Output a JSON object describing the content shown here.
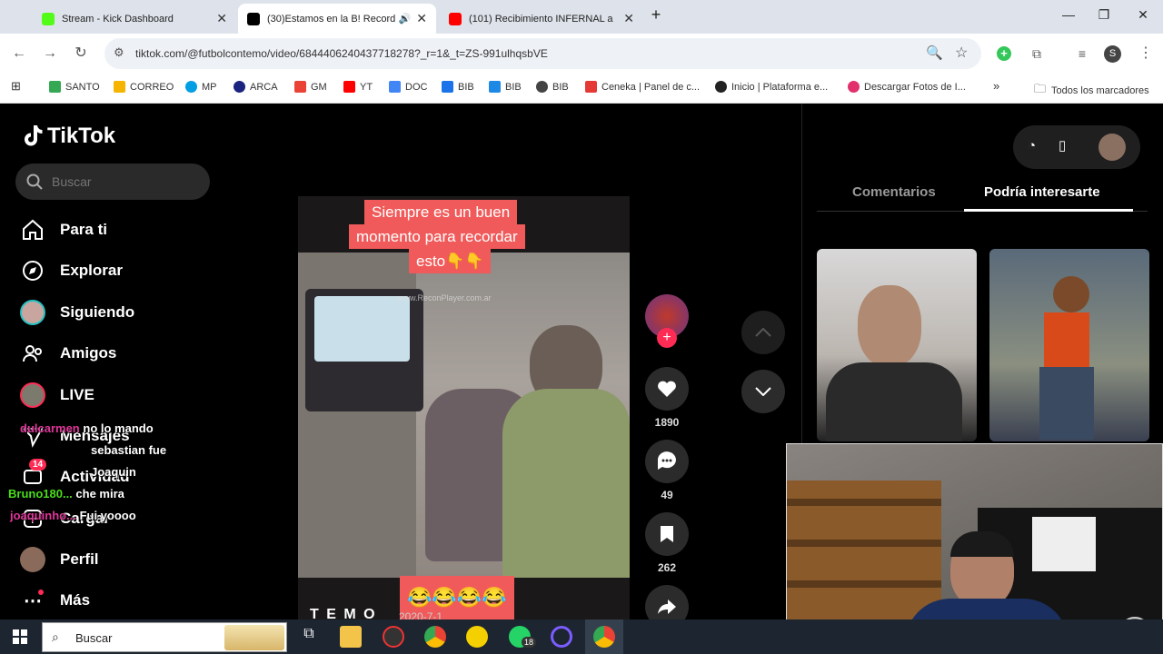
{
  "browser": {
    "tabs": [
      {
        "title": "Stream - Kick Dashboard",
        "color": "#53fc18"
      },
      {
        "title": "(30)Estamos en la B! Recorda",
        "color": "#000000"
      },
      {
        "title": "(101) Recibimiento INFERNAL a",
        "color": "#ff0000"
      }
    ],
    "new_tab": "+",
    "url": "tiktok.com/@futbolcontemo/video/6844406240437718278?_r=1&_t=ZS-991ulhqsbVE",
    "profile_letter": "S",
    "bookmarks": [
      {
        "label": "SANTO",
        "color": "#34a853"
      },
      {
        "label": "CORREO",
        "color": "#f4b400"
      },
      {
        "label": "MP",
        "color": "#009ee3"
      },
      {
        "label": "ARCA",
        "color": "#1a237e"
      },
      {
        "label": "GM",
        "color": "#ea4335"
      },
      {
        "label": "YT",
        "color": "#ff0000"
      },
      {
        "label": "DOC",
        "color": "#4285f4"
      },
      {
        "label": "BIB",
        "color": "#1a73e8"
      },
      {
        "label": "BIB",
        "color": "#1e88e5"
      },
      {
        "label": "BIB",
        "color": "#444444"
      },
      {
        "label": "Ceneka | Panel de c...",
        "color": "#e53935"
      },
      {
        "label": "Inicio | Plataforma e...",
        "color": "#222222"
      },
      {
        "label": "Descargar Fotos de I...",
        "color": "#e1306c"
      }
    ],
    "bookmarks_more": "»",
    "all_bookmarks": "Todos los marcadores"
  },
  "tiktok": {
    "logo": "TikTok",
    "search_placeholder": "Buscar",
    "nav": [
      {
        "label": "Para ti",
        "icon": "home-icon"
      },
      {
        "label": "Explorar",
        "icon": "compass-icon"
      },
      {
        "label": "Siguiendo",
        "icon": "avatar"
      },
      {
        "label": "Amigos",
        "icon": "people-icon"
      },
      {
        "label": "LIVE",
        "icon": "avatar"
      },
      {
        "label": "Mensajes",
        "icon": "send-icon"
      },
      {
        "label": "Actividad",
        "icon": "inbox-icon"
      },
      {
        "label": "Cargar",
        "icon": "upload-icon"
      },
      {
        "label": "Perfil",
        "icon": "avatar"
      },
      {
        "label": "Más",
        "icon": "more-icon"
      }
    ],
    "activity_badge": "14",
    "video": {
      "caption_line1": "Siempre es un buen",
      "caption_line2": "momento para recordar",
      "caption_line3": "esto👇👇",
      "bottom_caption": "😂😂😂😂",
      "author": "T E M O",
      "date": "2020-7-1",
      "watermark": "www.ReconPlayer.com.ar"
    },
    "actions": {
      "likes": "1890",
      "comments": "49",
      "saves": "262"
    },
    "right_tabs": {
      "comments": "Comentarios",
      "suggested": "Podría interesarte"
    }
  },
  "chat_overlay": [
    {
      "user": "dulcarmen",
      "message": "no lo mando",
      "user_color": "#e0369a"
    },
    {
      "user": "",
      "message": "sebastian fue",
      "user_color": "#ffffff"
    },
    {
      "user": "",
      "message": "Joaquin",
      "user_color": "#ffffff"
    },
    {
      "user": "Bruno180...",
      "message": "che mira",
      "user_color": "#4ade1a"
    },
    {
      "user": "joaquinho...",
      "message": "Fui yoooo",
      "user_color": "#e0369a"
    }
  ],
  "taskbar": {
    "search_placeholder": "Buscar",
    "whatsapp_badge": "18"
  }
}
